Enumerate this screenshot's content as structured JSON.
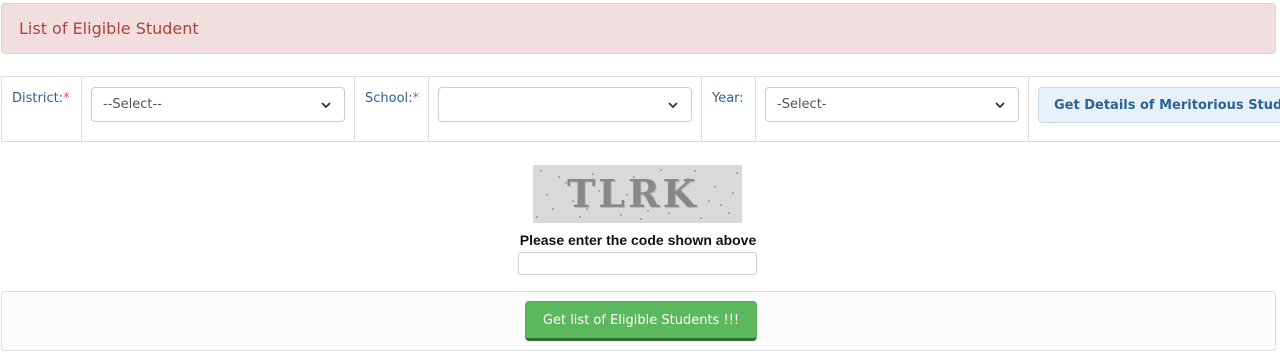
{
  "header": {
    "title": "List of Eligible Student"
  },
  "filters": {
    "district": {
      "label": "District:",
      "required_mark": "*",
      "value": "--Select--"
    },
    "school": {
      "label": "School:",
      "required_mark": "*",
      "value": ""
    },
    "year": {
      "label": "Year:",
      "value": "-Select-"
    },
    "details_button_label": "Get Details of Meritorious Students"
  },
  "captcha": {
    "code": "TLRK",
    "prompt": "Please enter the code shown above",
    "input_value": ""
  },
  "actions": {
    "submit_label": "Get list of Eligible Students !!!"
  },
  "colors": {
    "header_bg": "#f2dede",
    "header_text": "#a94442",
    "label_text": "#2a6496",
    "required": "#d9534f",
    "primary_green": "#5cb85c"
  }
}
